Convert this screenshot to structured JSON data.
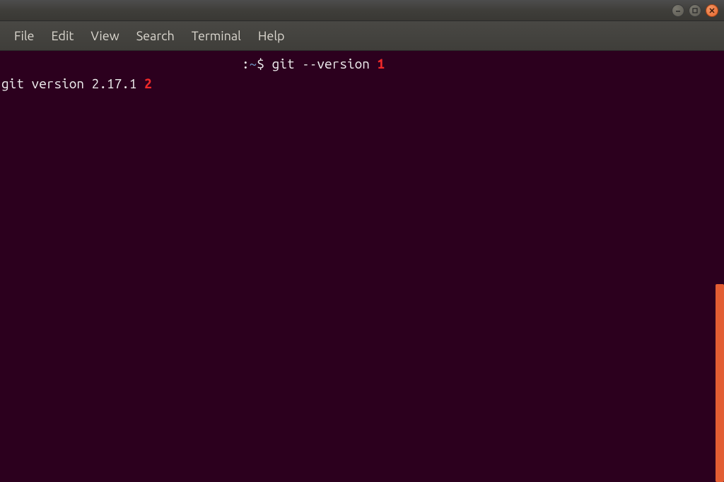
{
  "menubar": {
    "items": [
      "File",
      "Edit",
      "View",
      "Search",
      "Terminal",
      "Help"
    ]
  },
  "terminal": {
    "prompt": {
      "colon": ":",
      "tilde": "~",
      "dollar": "$ "
    },
    "command": "git --version",
    "annotation1": " 1",
    "output": "git version 2.17.1",
    "annotation2": " 2"
  }
}
